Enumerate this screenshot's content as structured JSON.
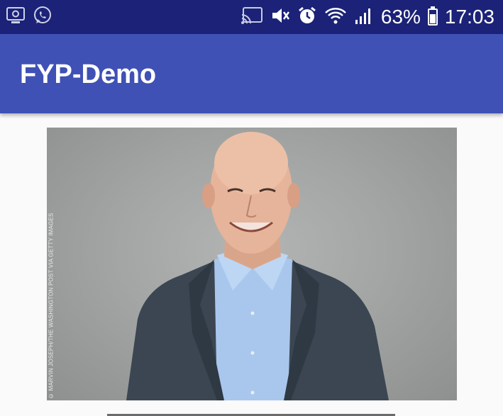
{
  "status_bar": {
    "left_icons": [
      "screen-capture-icon",
      "whatsapp-icon"
    ],
    "right_icons": [
      "cast-icon",
      "mute-icon",
      "alarm-icon",
      "wifi-icon",
      "signal-icon",
      "battery-icon"
    ],
    "battery": "63%",
    "time": "17:03"
  },
  "app_bar": {
    "title": "FYP-Demo",
    "color": "#3f51b5"
  },
  "content": {
    "photo": {
      "credit": "© MARVIN JOSEPH/THE WASHINGTON POST VIA GETTY IMAGES"
    }
  },
  "colors": {
    "status_bar": "#1b2277",
    "app_bar": "#3f51b5",
    "background": "#fafafa"
  }
}
